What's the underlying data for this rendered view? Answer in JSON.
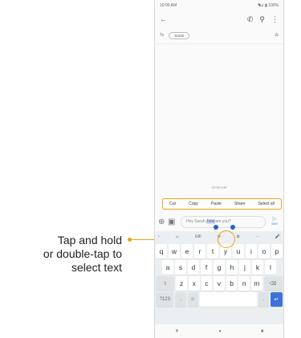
{
  "callout": {
    "line1": "Tap and hold",
    "line2": "or double-tap to",
    "line3": "select text"
  },
  "status": {
    "time": "10:00 AM",
    "signal": "◥⊿ ▮ 100%"
  },
  "appbar": {
    "back": "←",
    "call": "✆",
    "search": "⚲",
    "more": "⋮"
  },
  "to": {
    "label": "To",
    "chip": "Sarah",
    "add": "⁂"
  },
  "conversation": {
    "timestamp": "10:00 AM"
  },
  "context_menu": [
    "Cut",
    "Copy",
    "Paste",
    "Share",
    "Select all"
  ],
  "compose": {
    "before": "Hey Sarah, ",
    "selected": "how",
    "after": " are you?",
    "send_icon": "▷",
    "send_label": "SMS"
  },
  "keyboard": {
    "tools": [
      "‹",
      "☺",
      "GIF",
      "⚙",
      "✿",
      "···",
      "🎤"
    ],
    "row1": [
      "q",
      "w",
      "e",
      "r",
      "t",
      "y",
      "u",
      "i",
      "o",
      "p"
    ],
    "row2": [
      "a",
      "s",
      "d",
      "f",
      "g",
      "h",
      "j",
      "k",
      "l"
    ],
    "row3": [
      "⇧",
      "z",
      "x",
      "c",
      "v",
      "b",
      "n",
      "m",
      "⌫"
    ],
    "row4": [
      "?123",
      ",",
      "☺",
      " ",
      ".",
      "↵"
    ]
  },
  "nav": {
    "back": "▼",
    "home": "●",
    "recents": "■"
  }
}
